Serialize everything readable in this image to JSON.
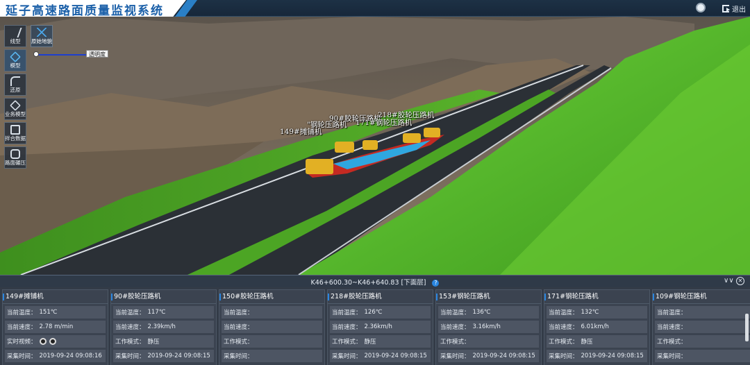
{
  "header": {
    "title": "延子高速路面质量监视系统",
    "logout_label": "退出"
  },
  "toolbar": {
    "items": [
      {
        "label": "线型",
        "icon": "line-type-icon"
      },
      {
        "label": "模型",
        "icon": "cube-icon"
      },
      {
        "label": "还原",
        "icon": "undo-icon"
      },
      {
        "label": "业务模型",
        "icon": "layers-icon"
      },
      {
        "label": "拌合数据",
        "icon": "mixer-icon"
      },
      {
        "label": "路面碾压",
        "icon": "roller-icon"
      }
    ],
    "terrain_label": "原始地貌",
    "opacity_label": "透明度",
    "opacity_value": 1.0
  },
  "scene": {
    "machine_labels": [
      "149#摊铺机",
      "90#胶轮压路机",
      "\"钢轮压路机",
      "218#胶轮压路机",
      "171#钢轮压路机"
    ]
  },
  "panel": {
    "stake_range": "K46+600.30~K46+640.83 [下面层]",
    "cards": [
      {
        "title": "149#摊铺机",
        "rows": [
          {
            "key": "当前温度：",
            "value": "151℃"
          },
          {
            "key": "当前速度：",
            "value": "2.78 m/min"
          },
          {
            "key": "实时视频：",
            "value": "",
            "video": true
          },
          {
            "key": "采集时间：",
            "value": "2019-09-24 09:08:16"
          }
        ]
      },
      {
        "title": "90#胶轮压路机",
        "rows": [
          {
            "key": "当前温度：",
            "value": "117℃"
          },
          {
            "key": "当前速度：",
            "value": "2.39km/h"
          },
          {
            "key": "工作模式：",
            "value": "静压"
          },
          {
            "key": "采集时间：",
            "value": "2019-09-24 09:08:15"
          }
        ]
      },
      {
        "title": "150#胶轮压路机",
        "rows": [
          {
            "key": "当前温度：",
            "value": ""
          },
          {
            "key": "当前速度：",
            "value": ""
          },
          {
            "key": "工作模式：",
            "value": ""
          },
          {
            "key": "采集时间：",
            "value": ""
          }
        ]
      },
      {
        "title": "218#胶轮压路机",
        "rows": [
          {
            "key": "当前温度：",
            "value": "126℃"
          },
          {
            "key": "当前速度：",
            "value": "2.36km/h"
          },
          {
            "key": "工作模式：",
            "value": "静压"
          },
          {
            "key": "采集时间：",
            "value": "2019-09-24 09:08:15"
          }
        ]
      },
      {
        "title": "153#钢轮压路机",
        "rows": [
          {
            "key": "当前温度：",
            "value": "136℃"
          },
          {
            "key": "当前速度：",
            "value": "3.16km/h"
          },
          {
            "key": "工作模式：",
            "value": ""
          },
          {
            "key": "采集时间：",
            "value": "2019-09-24 09:08:15"
          }
        ]
      },
      {
        "title": "171#钢轮压路机",
        "rows": [
          {
            "key": "当前温度：",
            "value": "132℃"
          },
          {
            "key": "当前速度：",
            "value": "6.01km/h"
          },
          {
            "key": "工作模式：",
            "value": "静压"
          },
          {
            "key": "采集时间：",
            "value": "2019-09-24 09:08:15"
          }
        ]
      },
      {
        "title": "109#钢轮压路机",
        "rows": [
          {
            "key": "当前温度：",
            "value": ""
          },
          {
            "key": "当前速度：",
            "value": ""
          },
          {
            "key": "工作模式：",
            "value": ""
          },
          {
            "key": "采集时间：",
            "value": ""
          }
        ]
      }
    ]
  },
  "colors": {
    "accent": "#2a86e0",
    "title_text": "#1a5fa8",
    "grass": "#5fbf2c",
    "asphalt": "#2b3036"
  }
}
